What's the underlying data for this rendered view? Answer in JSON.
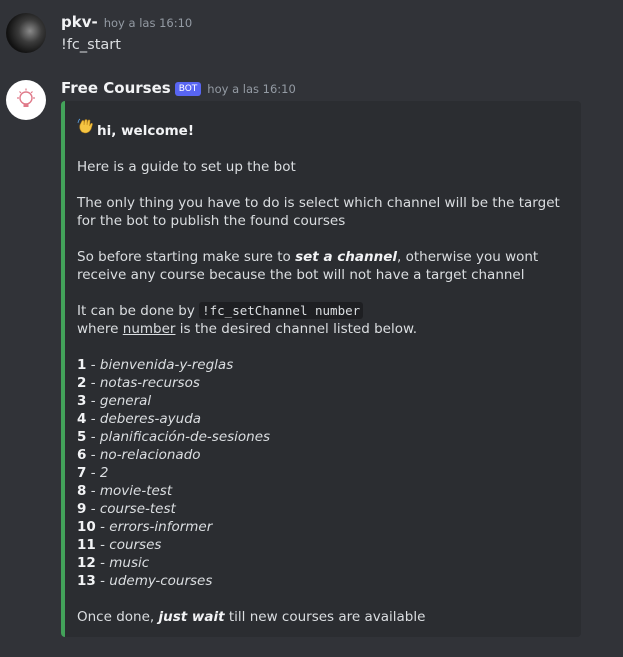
{
  "messages": {
    "first": {
      "username": "pkv-",
      "timestamp": "hoy a las 16:10",
      "content": "!fc_start"
    },
    "second": {
      "username": "Free Courses",
      "bot_tag": "BOT",
      "timestamp": "hoy a las 16:10"
    }
  },
  "embed": {
    "accent_color": "#43a25a",
    "welcome": "hi, welcome!",
    "guide": "Here is a guide to set up the bot",
    "only_thing": "The only thing you have to do is select which channel will be the target for the bot to publish the found courses",
    "before_1": "So before starting make sure to ",
    "before_bold": "set a channel",
    "before_2": ", otherwise you wont receive any course because the bot will not have a target channel",
    "done_by": "It can be done by ",
    "command": "!fc_setChannel number",
    "where_1": "where ",
    "where_underline": "number",
    "where_2": " is the desired channel listed below.",
    "channels": [
      {
        "num": "1",
        "name": "bienvenida-y-reglas"
      },
      {
        "num": "2",
        "name": "notas-recursos"
      },
      {
        "num": "3",
        "name": "general"
      },
      {
        "num": "4",
        "name": "deberes-ayuda"
      },
      {
        "num": "5",
        "name": "planificación-de-sesiones"
      },
      {
        "num": "6",
        "name": "no-relacionado"
      },
      {
        "num": "7",
        "name": "2"
      },
      {
        "num": "8",
        "name": "movie-test"
      },
      {
        "num": "9",
        "name": "course-test"
      },
      {
        "num": "10",
        "name": "errors-informer"
      },
      {
        "num": "11",
        "name": "courses"
      },
      {
        "num": "12",
        "name": "music"
      },
      {
        "num": "13",
        "name": "udemy-courses"
      }
    ],
    "separator": " - ",
    "once_1": "Once done, ",
    "once_bold": "just wait",
    "once_2": " till new courses are available"
  },
  "colors": {
    "background": "#313338",
    "embed_background": "#2b2d31",
    "bot_tag": "#5865f2"
  }
}
